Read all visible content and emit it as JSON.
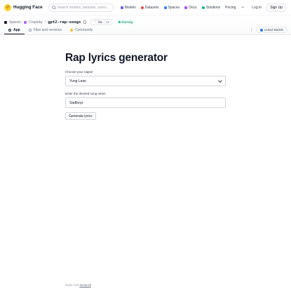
{
  "topbar": {
    "brand": "Hugging Face",
    "search_placeholder": "Search models, datasets, users...",
    "nav": {
      "models": "Models",
      "datasets": "Datasets",
      "spaces": "Spaces",
      "docs": "Docs",
      "solutions": "Solutions",
      "pricing": "Pricing"
    },
    "login": "Log In",
    "signup": "Sign Up"
  },
  "space": {
    "section": "Spaces:",
    "owner": "Cropinky",
    "repo": "gpt2-rap-songs",
    "like_label": "like",
    "like_count": "12",
    "status": "Running",
    "tabs": {
      "app": "App",
      "files": "Files and versions",
      "community": "Community"
    },
    "linked_models": "Linked Models"
  },
  "app": {
    "title": "Rap lyrics generator",
    "rapper_label": "Choose your rapper",
    "rapper_value": "Yung Lean",
    "song_label": "Enter the desired song name",
    "song_value": "Sadboys",
    "generate_button": "Generate lyrics"
  },
  "footer": {
    "made_with": "Made with",
    "link": "Streamlit"
  }
}
